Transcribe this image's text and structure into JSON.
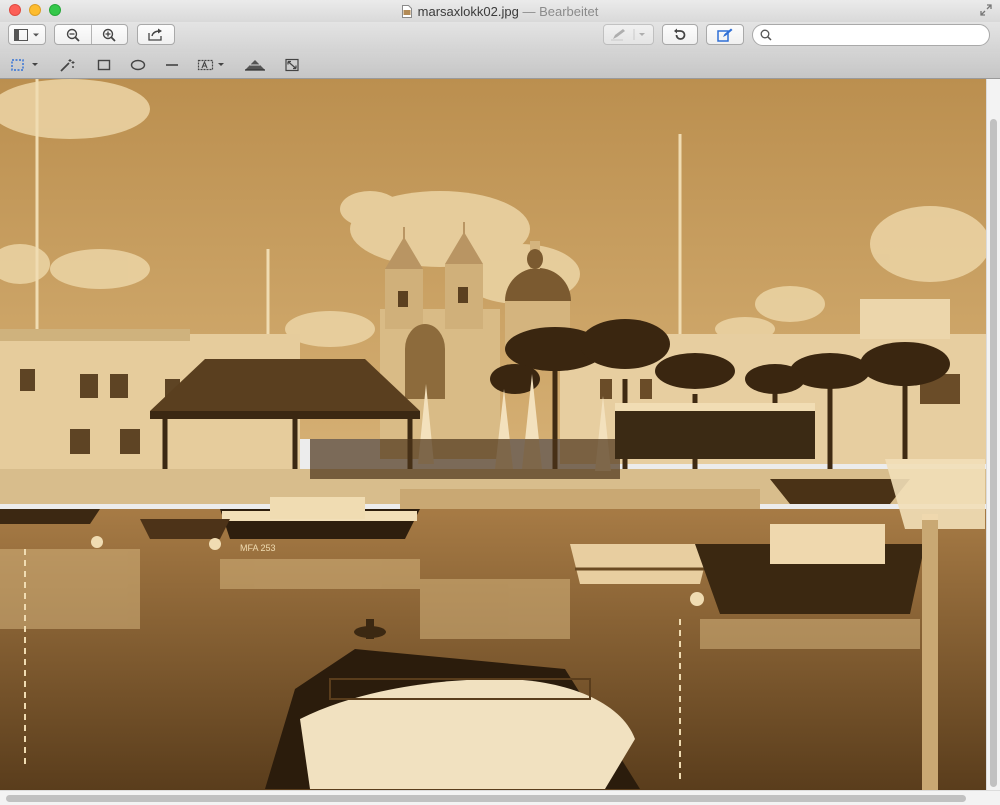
{
  "window": {
    "filename": "marsaxlokk02.jpg",
    "separator": "—",
    "status": "Bearbeitet"
  },
  "toolbar": {
    "search": {
      "placeholder": "",
      "value": ""
    },
    "icons": [
      "sidebar-icon",
      "zoom-out-icon",
      "zoom-in-icon",
      "share-icon",
      "pen-icon",
      "rotate-icon",
      "edit-toolbar-icon",
      "search-icon"
    ]
  },
  "markup": {
    "tools": [
      "rectangular-selection",
      "instant-alpha",
      "rectangle",
      "oval",
      "line",
      "text",
      "adjust-color",
      "adjust-size"
    ]
  },
  "photo": {
    "description_colors": {
      "sky": "#c49a58",
      "sepia_dark": "#3a2712",
      "sepia_light": "#f1ddb4"
    },
    "boat_labels": [
      "MFA 253"
    ]
  },
  "colors": {
    "accent_blue": "#2f6fd6"
  }
}
